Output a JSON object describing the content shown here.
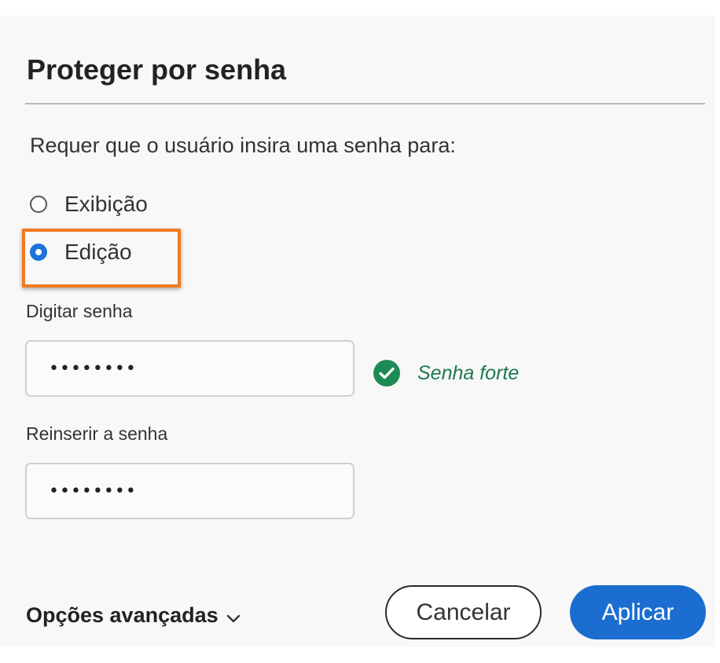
{
  "dialog": {
    "title": "Proteger por senha",
    "prompt": "Requer que o usuário insira uma senha para:",
    "options": [
      {
        "label": "Exibição",
        "checked": false
      },
      {
        "label": "Edição",
        "checked": true
      }
    ],
    "password": {
      "label": "Digitar senha",
      "value": "••••••••",
      "strength_text": "Senha forte",
      "strength_icon": "check-circle-icon"
    },
    "confirm": {
      "label": "Reinserir a senha",
      "value": "••••••••"
    },
    "advanced_label": "Opções avançadas",
    "cancel_label": "Cancelar",
    "apply_label": "Aplicar"
  },
  "colors": {
    "accent": "#1b6ed0",
    "highlight": "#f07a20",
    "success": "#1e8a55"
  }
}
